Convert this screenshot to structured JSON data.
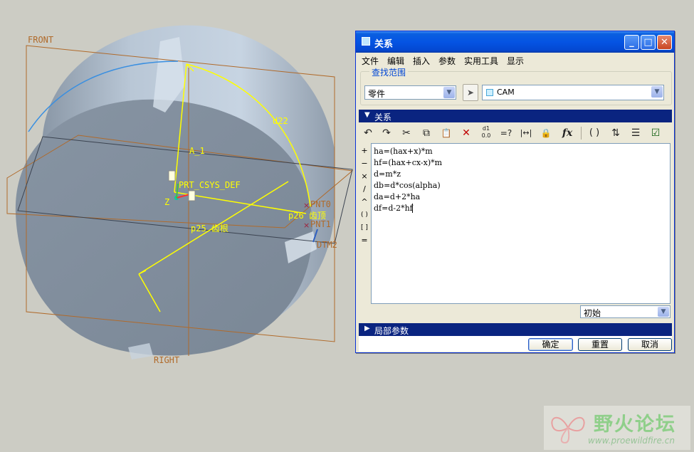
{
  "viewport": {
    "datum_labels": {
      "front": "FRONT",
      "right": "RIGHT",
      "a1": "A_1",
      "csys": "PRT_CSYS_DEF",
      "z_axis": "Z",
      "x_axis": "X",
      "pnt0": "PNT0",
      "pnt1": "PNT1",
      "dtm2": "DTM2"
    },
    "dimension_labels": {
      "d22": "d22",
      "p26": "p26 齿顶",
      "p25": "p25 齿根"
    },
    "colors": {
      "background": "#ccccc4",
      "part_light": "#bccbdb",
      "part_dark": "#8c99a8",
      "datum": "#b06a2a",
      "sketch": "#ffff00",
      "curve": "#3a8fe0"
    }
  },
  "dialog": {
    "title": "关系",
    "window_buttons": {
      "minimize": "_",
      "maximize": "□",
      "close": "✕"
    },
    "menu": [
      "文件",
      "编辑",
      "插入",
      "参数",
      "实用工具",
      "显示"
    ],
    "scope": {
      "legend": "查找范围",
      "type_value": "零件",
      "model_value": "CAM"
    },
    "relations_section": {
      "label": "关系"
    },
    "toolbar": {
      "undo": "↶",
      "redo": "↷",
      "cut": "✂",
      "copy": "⧉",
      "paste": "📋",
      "delete": "✕",
      "number_format": "d1\n0.0",
      "evaluate": "=?",
      "sort": "|↔|",
      "verify": "🔒",
      "function": "fx",
      "parentheses": "( )",
      "sort_relations": "⇅",
      "display": "☰",
      "check": "☑"
    },
    "operators": [
      "+",
      "−",
      "×",
      "/",
      "^",
      "( )",
      "[ ]",
      "="
    ],
    "relations": [
      "ha=(hax+x)*m",
      "hf=(hax+cx-x)*m",
      "d=m*z",
      "db=d*cos(alpha)",
      "da=d+2*ha",
      "df=d-2*hf"
    ],
    "initial_combo": "初始",
    "local_params_section": {
      "label": "局部参数"
    },
    "buttons": {
      "ok": "确定",
      "reset": "重置",
      "cancel": "取消"
    }
  },
  "watermark": {
    "cn": "野火论坛",
    "url": "www.proewildfire.cn"
  }
}
